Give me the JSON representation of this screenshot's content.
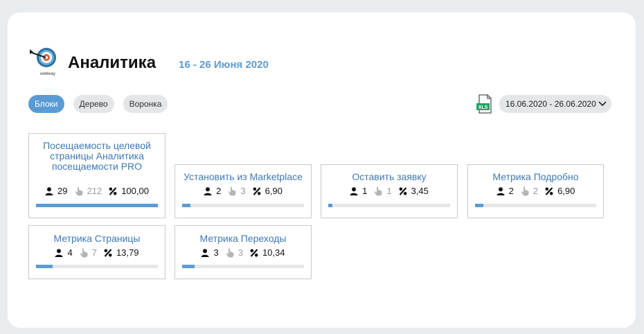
{
  "header": {
    "logo_text": "webway",
    "title": "Аналитика",
    "period": "16 - 26 Июня 2020"
  },
  "tabs": [
    {
      "label": "Блоки",
      "active": true
    },
    {
      "label": "Дерево",
      "active": false
    },
    {
      "label": "Воронка",
      "active": false
    }
  ],
  "export": {
    "icon": "xls-file-icon",
    "label": "XLS",
    "color": "#21a366"
  },
  "date_range": {
    "value": "16.06.2020 - 26.06.2020",
    "icon": "chevron-down-icon"
  },
  "colors": {
    "accent": "#5b9bd5",
    "link": "#3c78b5",
    "muted": "#9a9a9a"
  },
  "blocks": [
    {
      "title": "Посещаемость целевой страницы Аналитика посещаемости PRO",
      "users": "29",
      "clicks": "212",
      "percent": "100,00",
      "progress": 1.0
    },
    {
      "title": "Установить из Marketplace",
      "users": "2",
      "clicks": "3",
      "percent": "6,90",
      "progress": 0.069
    },
    {
      "title": "Оставить заявку",
      "users": "1",
      "clicks": "1",
      "percent": "3,45",
      "progress": 0.0345
    },
    {
      "title": "Метрика Подробно",
      "users": "2",
      "clicks": "2",
      "percent": "6,90",
      "progress": 0.069
    },
    {
      "title": "Метрика Страницы",
      "users": "4",
      "clicks": "7",
      "percent": "13,79",
      "progress": 0.1379
    },
    {
      "title": "Метрика Переходы",
      "users": "3",
      "clicks": "3",
      "percent": "10,34",
      "progress": 0.1034
    }
  ]
}
